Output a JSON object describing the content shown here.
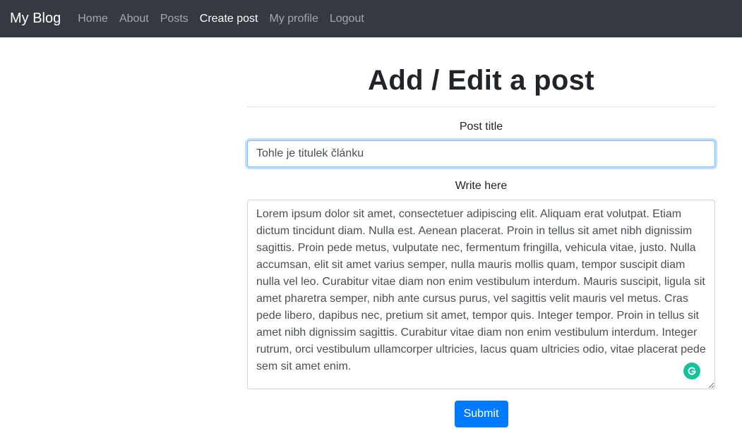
{
  "navbar": {
    "brand": "My Blog",
    "links": [
      {
        "label": "Home"
      },
      {
        "label": "About"
      },
      {
        "label": "Posts"
      },
      {
        "label": "Create post"
      },
      {
        "label": "My profile"
      },
      {
        "label": "Logout"
      }
    ],
    "active_link": "Create post",
    "background": "#343a40"
  },
  "form": {
    "heading": "Add / Edit a post",
    "title_label": "Post title",
    "title_value": "Tohle je titulek článku",
    "body_label": "Write here",
    "body_value": "Lorem ipsum dolor sit amet, consectetuer adipiscing elit. Aliquam erat volutpat. Etiam dictum tincidunt diam. Nulla est. Aenean placerat. Proin in tellus sit amet nibh dignissim sagittis. Proin pede metus, vulputate nec, fermentum fringilla, vehicula vitae, justo. Nulla accumsan, elit sit amet varius semper, nulla mauris mollis quam, tempor suscipit diam nulla vel leo. Curabitur vitae diam non enim vestibulum interdum. Mauris suscipit, ligula sit amet pharetra semper, nibh ante cursus purus, vel sagittis velit mauris vel metus. Cras pede libero, dapibus nec, pretium sit amet, tempor quis. Integer tempor. Proin in tellus sit amet nibh dignissim sagittis. Curabitur vitae diam non enim vestibulum interdum. Integer rutrum, orci vestibulum ullamcorper ultricies, lacus quam ultricies odio, vitae placerat pede sem sit amet enim.",
    "grammarly_icon": "grammarly-icon",
    "submit_label": "Submit",
    "accent_color": "#007bff"
  }
}
